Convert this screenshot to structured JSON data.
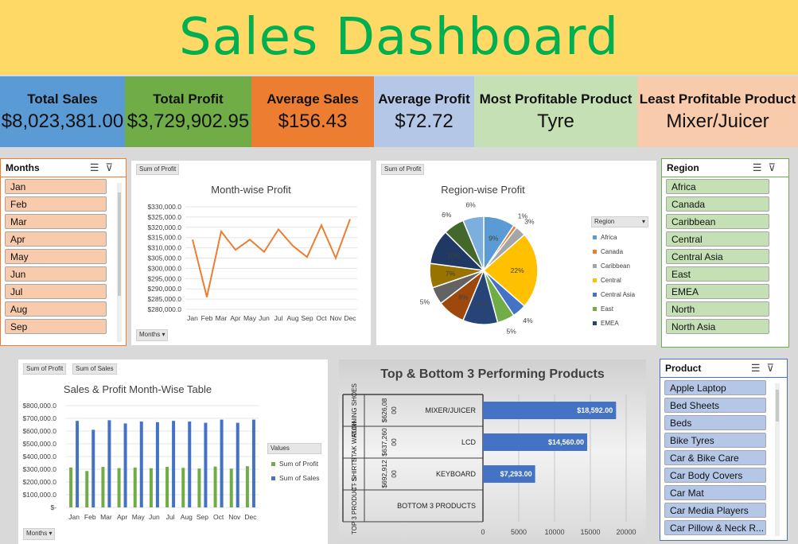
{
  "title": "Sales Dashboard",
  "kpis": [
    {
      "label": "Total Sales",
      "value": "$8,023,381.00",
      "color": "#5b9bd5"
    },
    {
      "label": "Total Profit",
      "value": "$3,729,902.95",
      "color": "#70ad47"
    },
    {
      "label": "Average Sales",
      "value": "$156.43",
      "color": "#ed7d31"
    },
    {
      "label": "Average Profit",
      "value": "$72.72",
      "color": "#b4c7e7"
    },
    {
      "label": "Most Profitable Product",
      "value": "Tyre",
      "color": "#c5e0b4"
    },
    {
      "label": "Least Profitable Product",
      "value": "Mixer/Juicer",
      "color": "#f8cbad"
    }
  ],
  "months_slicer": {
    "header": "Months",
    "items": [
      "Jan",
      "Feb",
      "Mar",
      "Apr",
      "May",
      "Jun",
      "Jul",
      "Aug",
      "Sep"
    ],
    "color": "#f8cbad"
  },
  "region_slicer": {
    "header": "Region",
    "items": [
      "Africa",
      "Canada",
      "Caribbean",
      "Central",
      "Central Asia",
      "East",
      "EMEA",
      "North",
      "North Asia"
    ],
    "color": "#c5e0b4"
  },
  "product_slicer": {
    "header": "Product",
    "items": [
      "Apple Laptop",
      "Bed Sheets",
      "Beds",
      "Bike Tyres",
      "Car & Bike Care",
      "Car Body Covers",
      "Car Mat",
      "Car Media Players",
      "Car Pillow & Neck R..."
    ],
    "color": "#b4c7e7"
  },
  "profit_chart": {
    "tag": "Sum of Profit",
    "filter": "Months",
    "chart_data": {
      "type": "line",
      "title": "Month-wise Profit",
      "categories": [
        "Jan",
        "Feb",
        "Mar",
        "Apr",
        "May",
        "Jun",
        "Jul",
        "Aug",
        "Sep",
        "Oct",
        "Nov",
        "Dec"
      ],
      "values": [
        314000,
        286000,
        318000,
        309000,
        314000,
        308000,
        319000,
        311000,
        305500,
        321000,
        305000,
        324000
      ],
      "ylim": [
        280000,
        330000
      ],
      "yticks": [
        "$330,000.0",
        "$325,000.0",
        "$320,000.0",
        "$315,000.0",
        "$310,000.0",
        "$305,000.0",
        "$300,000.0",
        "$295,000.0",
        "$290,000.0",
        "$285,000.0",
        "$280,000.0"
      ],
      "color": "#ed7d31"
    }
  },
  "region_chart": {
    "tag": "Sum of Profit",
    "chart_data": {
      "type": "pie",
      "title": "Region-wise Profit",
      "legend_title": "Region",
      "legend": [
        "Africa",
        "Canada",
        "Caribbean",
        "Central",
        "Central Asia",
        "East",
        "EMEA"
      ],
      "slices": [
        {
          "label": "9%",
          "value": 9,
          "color": "#5b9bd5"
        },
        {
          "label": "1%",
          "value": 1,
          "color": "#ed7d31"
        },
        {
          "label": "3%",
          "value": 3,
          "color": "#a5a5a5"
        },
        {
          "label": "22%",
          "value": 22,
          "color": "#ffc000"
        },
        {
          "label": "4%",
          "value": 4,
          "color": "#4472c4"
        },
        {
          "label": "5%",
          "value": 5,
          "color": "#70ad47"
        },
        {
          "label": "10%",
          "value": 10,
          "color": "#264478"
        },
        {
          "label": "8%",
          "value": 8,
          "color": "#9e480e"
        },
        {
          "label": "5%",
          "value": 5,
          "color": "#636363"
        },
        {
          "label": "7%",
          "value": 7,
          "color": "#997300"
        },
        {
          "label": "10%",
          "value": 10,
          "color": "#1f3864"
        },
        {
          "label": "6%",
          "value": 6,
          "color": "#43682b"
        },
        {
          "label": "6%",
          "value": 6,
          "color": "#7cafdd"
        }
      ]
    }
  },
  "sales_profit_chart": {
    "tags": [
      "Sum of Profit",
      "Sum of Sales"
    ],
    "filter": "Months",
    "chart_data": {
      "type": "bar",
      "title": "Sales & Profit Month-Wise Table",
      "categories": [
        "Jan",
        "Feb",
        "Mar",
        "Apr",
        "May",
        "Jun",
        "Jul",
        "Aug",
        "Sep",
        "Oct",
        "Nov",
        "Dec"
      ],
      "series": [
        {
          "name": "Sum of Profit",
          "values": [
            314000,
            286000,
            318000,
            309000,
            314000,
            308000,
            319000,
            311000,
            305500,
            321000,
            305000,
            324000
          ],
          "color": "#70ad47"
        },
        {
          "name": "Sum of Sales",
          "values": [
            680000,
            610000,
            685000,
            660000,
            675000,
            670000,
            680000,
            675000,
            665000,
            690000,
            665000,
            690000
          ],
          "color": "#4472c4"
        }
      ],
      "ylim": [
        0,
        800000
      ],
      "yticks": [
        "$800,000.0",
        "$700,000.0",
        "$600,000.0",
        "$500,000.0",
        "$400,000.0",
        "$300,000.0",
        "$200,000.0",
        "$100,000.0",
        "$-"
      ],
      "legend_title": "Values"
    }
  },
  "top_bottom_chart": {
    "chart_data": {
      "type": "bar",
      "title": "Top & Bottom 3 Performing Products",
      "groups": [
        {
          "group": "RUNNING SHOES",
          "total": "$626,08",
          "sub": "00",
          "product": "MIXER/JUICER",
          "value": 18592,
          "label": "$18,592.00"
        },
        {
          "group": "TITAK WATCH",
          "total": "$637,260",
          "sub": "00",
          "product": "LCD",
          "value": 14560,
          "label": "$14,560.00"
        },
        {
          "group": "T - SHIRTS",
          "total": "$692,912",
          "sub": "00",
          "product": "KEYBOARD",
          "value": 7293,
          "label": "$7,293.00"
        },
        {
          "group": "TOP 3 PRODUCT S",
          "total": "",
          "sub": "",
          "product": "BOTTOM 3 PRODUCTS",
          "value": 0,
          "label": ""
        }
      ],
      "xticks": [
        "0",
        "5000",
        "10000",
        "15000",
        "20000"
      ],
      "xlim": [
        0,
        20000
      ],
      "color": "#4472c4"
    }
  }
}
